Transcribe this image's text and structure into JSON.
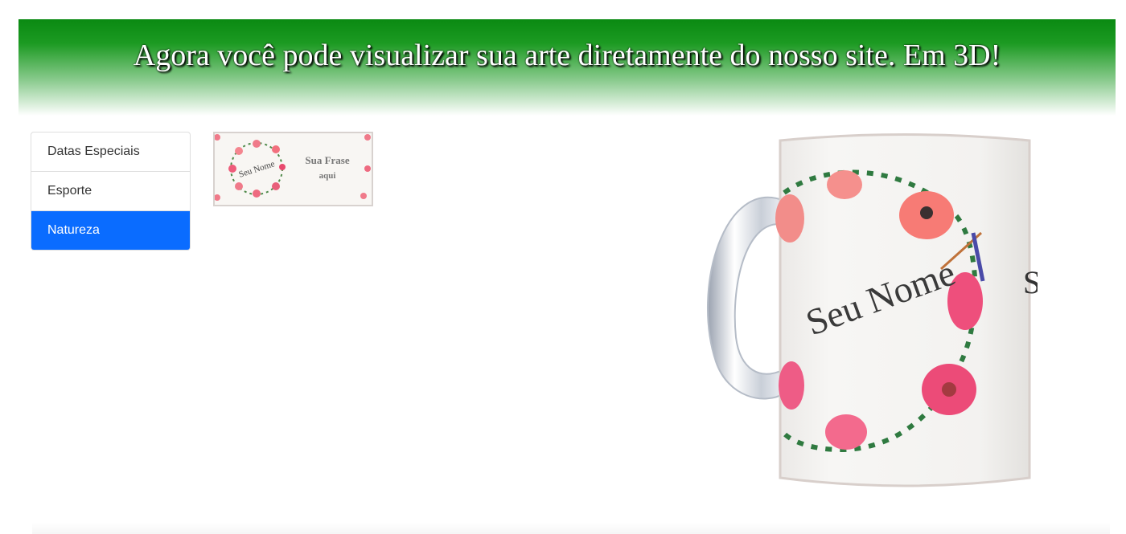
{
  "banner": {
    "title": "Agora você pode visualizar sua arte diretamente do nosso site. Em 3D!",
    "gradient_top": "#0a8a12"
  },
  "categories": [
    {
      "label": "Datas Especiais",
      "active": false
    },
    {
      "label": "Esporte",
      "active": false
    },
    {
      "label": "Natureza",
      "active": true
    }
  ],
  "accent_color": "#0a6cff",
  "art_thumbnail": {
    "name_text": "Seu Nome",
    "phrase_line1": "Sua Frase",
    "phrase_line2": "aqui"
  },
  "mug_preview": {
    "name_text": "Seu Nome",
    "side_glyph": "S"
  }
}
